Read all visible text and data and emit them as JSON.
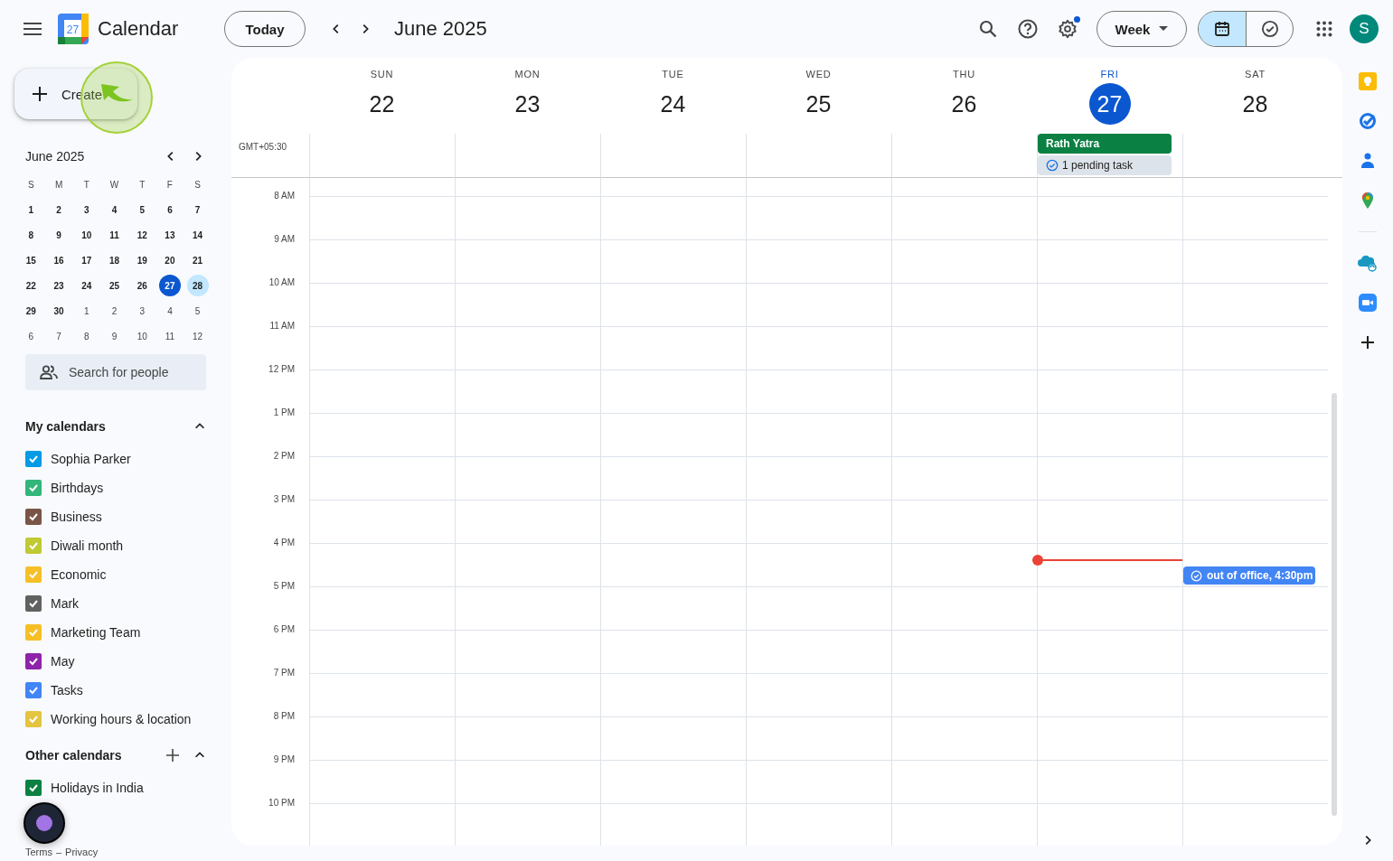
{
  "header": {
    "logo_date": "27",
    "app_title": "Calendar",
    "today_button": "Today",
    "period": "June 2025",
    "settings_badge": true,
    "view_select": "Week",
    "view_toggle": [
      {
        "kind": "calendar",
        "selected": true
      },
      {
        "kind": "tasks",
        "selected": false
      }
    ],
    "avatar": "S"
  },
  "create_button": {
    "label": "Create"
  },
  "mini_calendar": {
    "title": "June 2025",
    "weekdays": [
      "S",
      "M",
      "T",
      "W",
      "T",
      "F",
      "S"
    ],
    "days": [
      {
        "d": "1",
        "other": false,
        "today": false,
        "selected": false
      },
      {
        "d": "2",
        "other": false,
        "today": false,
        "selected": false
      },
      {
        "d": "3",
        "other": false,
        "today": false,
        "selected": false
      },
      {
        "d": "4",
        "other": false,
        "today": false,
        "selected": false
      },
      {
        "d": "5",
        "other": false,
        "today": false,
        "selected": false
      },
      {
        "d": "6",
        "other": false,
        "today": false,
        "selected": false
      },
      {
        "d": "7",
        "other": false,
        "today": false,
        "selected": false
      },
      {
        "d": "8",
        "other": false,
        "today": false,
        "selected": false
      },
      {
        "d": "9",
        "other": false,
        "today": false,
        "selected": false
      },
      {
        "d": "10",
        "other": false,
        "today": false,
        "selected": false
      },
      {
        "d": "11",
        "other": false,
        "today": false,
        "selected": false
      },
      {
        "d": "12",
        "other": false,
        "today": false,
        "selected": false
      },
      {
        "d": "13",
        "other": false,
        "today": false,
        "selected": false
      },
      {
        "d": "14",
        "other": false,
        "today": false,
        "selected": false
      },
      {
        "d": "15",
        "other": false,
        "today": false,
        "selected": false
      },
      {
        "d": "16",
        "other": false,
        "today": false,
        "selected": false
      },
      {
        "d": "17",
        "other": false,
        "today": false,
        "selected": false
      },
      {
        "d": "18",
        "other": false,
        "today": false,
        "selected": false
      },
      {
        "d": "19",
        "other": false,
        "today": false,
        "selected": false
      },
      {
        "d": "20",
        "other": false,
        "today": false,
        "selected": false
      },
      {
        "d": "21",
        "other": false,
        "today": false,
        "selected": false
      },
      {
        "d": "22",
        "other": false,
        "today": false,
        "selected": false
      },
      {
        "d": "23",
        "other": false,
        "today": false,
        "selected": false
      },
      {
        "d": "24",
        "other": false,
        "today": false,
        "selected": false
      },
      {
        "d": "25",
        "other": false,
        "today": false,
        "selected": false
      },
      {
        "d": "26",
        "other": false,
        "today": false,
        "selected": false
      },
      {
        "d": "27",
        "other": false,
        "today": true,
        "selected": false
      },
      {
        "d": "28",
        "other": false,
        "today": false,
        "selected": true
      },
      {
        "d": "29",
        "other": false,
        "today": false,
        "selected": false
      },
      {
        "d": "30",
        "other": false,
        "today": false,
        "selected": false
      },
      {
        "d": "1",
        "other": true,
        "today": false,
        "selected": false
      },
      {
        "d": "2",
        "other": true,
        "today": false,
        "selected": false
      },
      {
        "d": "3",
        "other": true,
        "today": false,
        "selected": false
      },
      {
        "d": "4",
        "other": true,
        "today": false,
        "selected": false
      },
      {
        "d": "5",
        "other": true,
        "today": false,
        "selected": false
      },
      {
        "d": "6",
        "other": true,
        "today": false,
        "selected": false
      },
      {
        "d": "7",
        "other": true,
        "today": false,
        "selected": false
      },
      {
        "d": "8",
        "other": true,
        "today": false,
        "selected": false
      },
      {
        "d": "9",
        "other": true,
        "today": false,
        "selected": false
      },
      {
        "d": "10",
        "other": true,
        "today": false,
        "selected": false
      },
      {
        "d": "11",
        "other": true,
        "today": false,
        "selected": false
      },
      {
        "d": "12",
        "other": true,
        "today": false,
        "selected": false
      }
    ]
  },
  "people_search": {
    "placeholder": "Search for people"
  },
  "my_calendars": {
    "title": "My calendars",
    "expanded": true,
    "items": [
      {
        "label": "Sophia Parker",
        "checked": true,
        "color": "#039be5"
      },
      {
        "label": "Birthdays",
        "checked": true,
        "color": "#33b679"
      },
      {
        "label": "Business",
        "checked": true,
        "color": "#795548"
      },
      {
        "label": "Diwali month",
        "checked": true,
        "color": "#c0ca33"
      },
      {
        "label": "Economic",
        "checked": true,
        "color": "#f6bf26"
      },
      {
        "label": "Mark",
        "checked": true,
        "color": "#616161"
      },
      {
        "label": "Marketing Team",
        "checked": true,
        "color": "#f6bf26"
      },
      {
        "label": "May",
        "checked": true,
        "color": "#8e24aa"
      },
      {
        "label": "Tasks",
        "checked": true,
        "color": "#4285f4"
      },
      {
        "label": "Working hours & location",
        "checked": true,
        "color": "#e4c441"
      }
    ]
  },
  "other_calendars": {
    "title": "Other calendars",
    "expanded": true,
    "items": [
      {
        "label": "Holidays in India",
        "checked": true,
        "color": "#0b8043"
      }
    ]
  },
  "footer": {
    "terms": "Terms",
    "separator": "–",
    "privacy": "Privacy"
  },
  "week": {
    "timezone": "GMT+05:30",
    "days": [
      {
        "dow": "SUN",
        "date": "22",
        "today": false
      },
      {
        "dow": "MON",
        "date": "23",
        "today": false
      },
      {
        "dow": "TUE",
        "date": "24",
        "today": false
      },
      {
        "dow": "WED",
        "date": "25",
        "today": false
      },
      {
        "dow": "THU",
        "date": "26",
        "today": false
      },
      {
        "dow": "FRI",
        "date": "27",
        "today": true,
        "all_day": [
          {
            "kind": "event",
            "title": "Rath Yatra",
            "color": "#0b8043"
          },
          {
            "kind": "task",
            "title": "1 pending task",
            "color": "#dde3ea"
          }
        ]
      },
      {
        "dow": "SAT",
        "date": "28",
        "today": false,
        "events": [
          {
            "kind": "task",
            "title": "out of office, 4:30pm",
            "color": "#4285f4"
          }
        ]
      }
    ],
    "hours": [
      "8 AM",
      "9 AM",
      "10 AM",
      "11 AM",
      "12 PM",
      "1 PM",
      "2 PM",
      "3 PM",
      "4 PM",
      "5 PM",
      "6 PM",
      "7 PM",
      "8 PM",
      "9 PM",
      "10 PM"
    ]
  },
  "side_apps": [
    {
      "kind": "keep"
    },
    {
      "kind": "tasks"
    },
    {
      "kind": "contacts"
    },
    {
      "kind": "maps"
    },
    {
      "kind": "salesforce"
    },
    {
      "kind": "zoom"
    }
  ]
}
